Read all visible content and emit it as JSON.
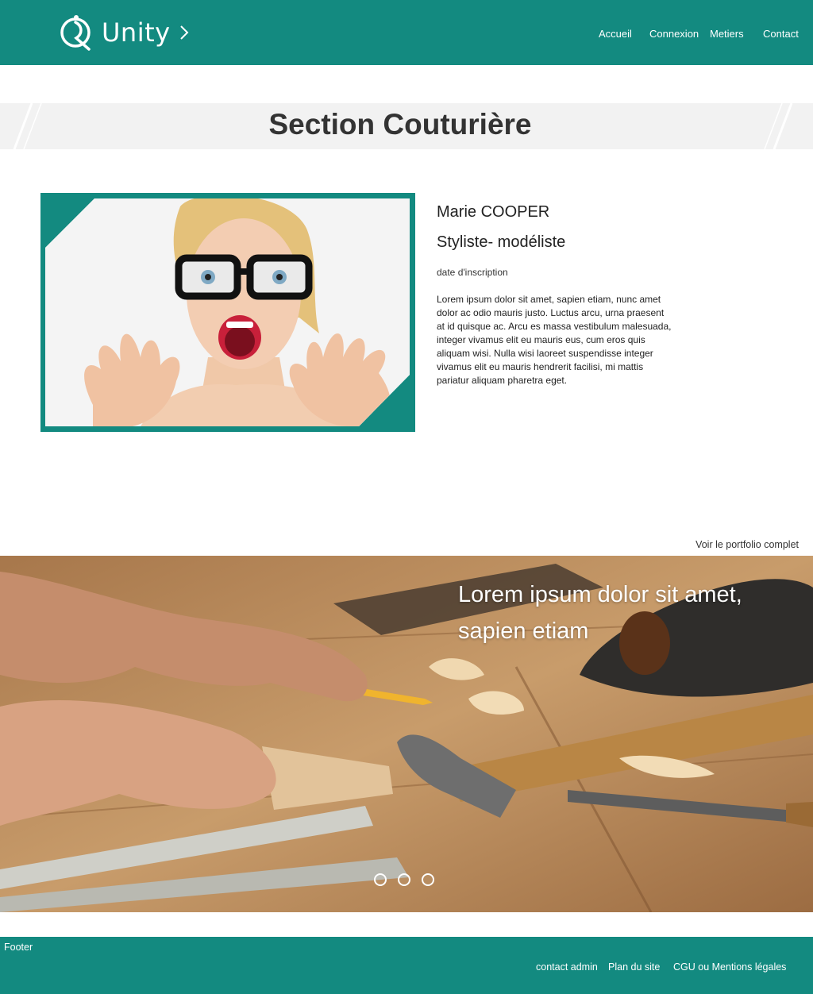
{
  "header": {
    "brand": "Unity",
    "nav": [
      "Accueil",
      "Connexion",
      "Metiers",
      "Contact"
    ]
  },
  "section": {
    "title": "Section Couturière"
  },
  "profile": {
    "name": "Marie COOPER",
    "role": "Styliste- modéliste",
    "date_label": "date d'inscription",
    "bio": "Lorem ipsum dolor sit amet, sapien etiam, nunc amet dolor ac odio mauris justo. Luctus arcu, urna praesent at id quisque ac. Arcu es massa vestibulum malesuada, integer vivamus elit eu mauris eus, cum eros quis aliquam wisi. Nulla wisi laoreet suspendisse integer vivamus elit eu mauris hendrerit facilisi, mi mattis pariatur aliquam pharetra eget."
  },
  "portfolio_link": "Voir le portfolio complet",
  "slider": {
    "caption": "Lorem ipsum dolor sit amet, sapien etiam",
    "slide_count": 3,
    "active_index": 0
  },
  "footer": {
    "label": "Footer",
    "links": [
      "contact admin",
      "Plan du site",
      "CGU ou Mentions légales"
    ]
  },
  "colors": {
    "brand": "#138a80",
    "band": "#f2f2f2",
    "text": "#333333"
  },
  "icons": {
    "logo": "unity-logo-icon",
    "chevron": "chevron-right-icon"
  }
}
